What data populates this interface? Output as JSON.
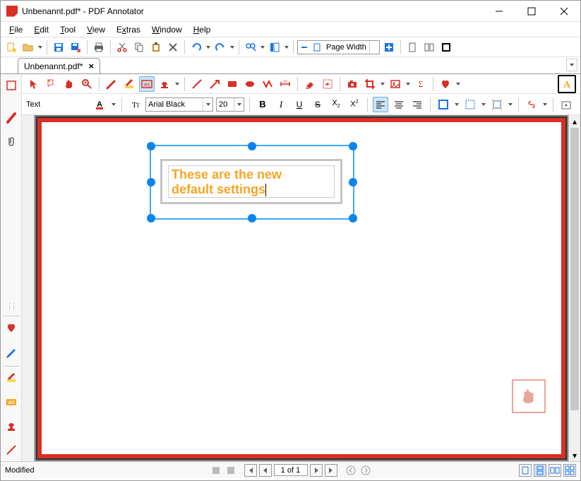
{
  "window": {
    "title": "Unbenannt.pdf* - PDF Annotator"
  },
  "menu": {
    "file": "File",
    "edit": "Edit",
    "tool": "Tool",
    "view": "View",
    "extras": "Extras",
    "window": "Window",
    "help": "Help"
  },
  "tab": {
    "label": "Unbenannt.pdf*"
  },
  "zoom": {
    "label": "Page Width"
  },
  "text_toolbar": {
    "label": "Text",
    "font": "Arial Black",
    "size": "20"
  },
  "document": {
    "text_line1": "These are the new",
    "text_line2": "default settings"
  },
  "status": {
    "modified": "Modified",
    "page": "1 of 1"
  }
}
